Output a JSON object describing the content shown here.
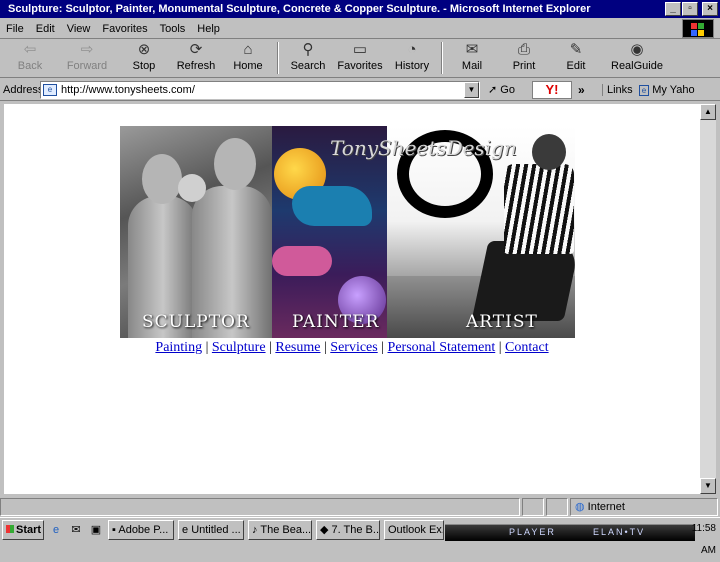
{
  "window": {
    "title": "Sculpture: Sculptor, Painter, Monumental Sculpture, Concrete & Copper Sculpture. - Microsoft Internet Explorer",
    "minimize": "_",
    "maximize": "▫",
    "close": "×"
  },
  "menubar": {
    "items": [
      "File",
      "Edit",
      "View",
      "Favorites",
      "Tools",
      "Help"
    ]
  },
  "toolbar": {
    "back": "Back",
    "forward": "Forward",
    "stop": "Stop",
    "refresh": "Refresh",
    "home": "Home",
    "search": "Search",
    "favorites": "Favorites",
    "history": "History",
    "mail": "Mail",
    "print": "Print",
    "edit": "Edit",
    "realguide": "RealGuide"
  },
  "address": {
    "label": "Address",
    "url": "http://www.tonysheets.com/",
    "go": "Go",
    "yahoo": "Y!",
    "chevron": "»",
    "links": "Links",
    "my_yahoo": "My Yaho"
  },
  "banner": {
    "script": "TonySheetsDesign",
    "sculptor": "SCULPTOR",
    "painter": "PAINTER",
    "artist": "ARTIST"
  },
  "nav": {
    "separator": " | ",
    "links": [
      "Painting",
      "Sculpture",
      "Resume",
      "Services",
      "Personal Statement",
      "Contact"
    ]
  },
  "status": {
    "zone": "Internet"
  },
  "taskbar": {
    "start": "Start",
    "tasks": [
      "Adobe P...",
      "Untitled ...",
      "The Bea...",
      "7. The B...",
      "Outlook Ex..."
    ],
    "player_left": "PLAYER",
    "player_right": "ELAN•TV",
    "clock": "11:58 AM"
  },
  "colors": {
    "title_bar": "#000080",
    "link": "#0000cc",
    "chrome": "#c0c0c0"
  }
}
